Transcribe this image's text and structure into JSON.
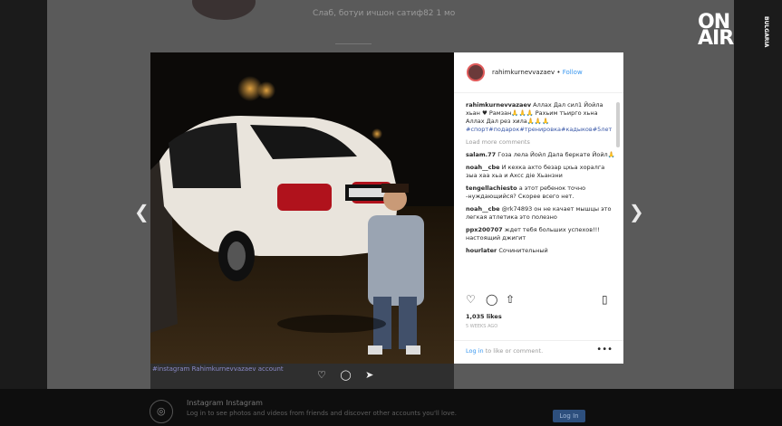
{
  "background": {
    "caption": "Слаб, ботуи ичшон сатиф82 1 мо"
  },
  "logo": {
    "text": "ON AIR",
    "sub": "BULGARIA"
  },
  "post": {
    "username": "rahimkurnevvazaev",
    "follow": "Follow",
    "caption_user": "rahimkurnevvazaev",
    "caption_text": "Аллах Дал сил1 Йойла хьан ♥ Рамзан🙏🙏🙏 Рахьим тъирго хьна Аллах Дал рез хила🙏🙏🙏",
    "caption_tags": "#спорт#подарок#тренировка#кадыков#5лет",
    "load_more": "Load more comments",
    "comments": [
      {
        "user": "salam.77",
        "text": "Гоза лела Йойл Дала беркате Йойл🙏"
      },
      {
        "user": "noah__cbe",
        "text": "И кехка ахто безар цхьа хоралга зыа хаа хьа и Ахсс діе Хьанзни"
      },
      {
        "user": "tengellachiesto",
        "text": "а этот ребенок точно -нуждающийся? Скорее всего нет."
      },
      {
        "user": "noah__cbe",
        "text": "@rk74893 он не качает мышцы это легкая атлетика это полезно"
      },
      {
        "user": "ppx200707",
        "text": "ждет тебя больших успехов!!! настоящий джигит"
      },
      {
        "user": "hourlater",
        "text": "Сочинительный"
      }
    ],
    "likes": "1,035 likes",
    "time": "5 WEEKS AGO",
    "login_link": "Log in",
    "login_text": "to like or comment."
  },
  "photo_strip": {
    "text": "#instagram Rahimkurnevvazaev account",
    "icons": "♡ ◯ ➤"
  },
  "footer": {
    "title": "Instagram Instagram",
    "text": "Log in to see photos and videos from friends and discover other accounts you'll love.",
    "button": "Log In"
  },
  "icons": {
    "prev": "chevron-left-icon",
    "next": "chevron-right-icon",
    "heart": "heart-icon",
    "comment": "comment-icon",
    "share": "share-icon",
    "bookmark": "bookmark-icon",
    "more": "more-icon",
    "instagram": "instagram-icon"
  }
}
